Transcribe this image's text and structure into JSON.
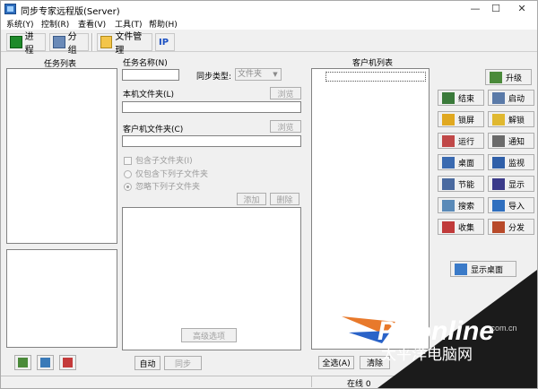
{
  "window": {
    "title": "同步专家远程版(Server)",
    "min": "—",
    "max": "☐",
    "close": "✕"
  },
  "menu": [
    "系统(Y)",
    "控制(R)",
    "查看(V)",
    "工具(T)",
    "帮助(H)"
  ],
  "toolbar": {
    "process": "进程",
    "group": "分组",
    "file_manager": "文件管理",
    "ip": "IP"
  },
  "task_list": {
    "header": "任务列表"
  },
  "task_form": {
    "name_label": "任务名称(N)",
    "name_value": "",
    "sync_type_label": "同步类型:",
    "sync_type_value": "文件夹",
    "local_folder_label": "本机文件夹(L)",
    "local_folder_value": "",
    "browse1": "浏览",
    "client_folder_label": "客户机文件夹(C)",
    "client_folder_value": "",
    "browse2": "浏览",
    "include_sub": "包含子文件夹(I)",
    "only_listed": "仅包含下列子文件夹",
    "ignore_listed": "忽略下列子文件夹",
    "add": "添加",
    "delete": "删除",
    "advanced": "高级选项",
    "auto": "自动",
    "sync": "同步"
  },
  "client_list": {
    "header": "客户机列表",
    "select_all": "全选(A)",
    "clear": "清除"
  },
  "actions": {
    "upgrade": "升级",
    "end": "结束",
    "start": "启动",
    "lock": "锁屏",
    "unlock": "解锁",
    "run": "运行",
    "notify": "通知",
    "desktop": "桌面",
    "monitor": "监视",
    "power": "节能",
    "display": "显示",
    "search": "搜索",
    "import": "导入",
    "collect": "收集",
    "distribute": "分发",
    "show_desktop": "显示桌面"
  },
  "status": {
    "online": "在线 0"
  },
  "watermark": {
    "logo": "PConline",
    "sub": "太平洋电脑网",
    "domain": ".com.cn"
  },
  "colors": {
    "window_bg": "#f0f0f0",
    "field_bg": "#ffffff",
    "accent_blue": "#2f6fbf"
  }
}
